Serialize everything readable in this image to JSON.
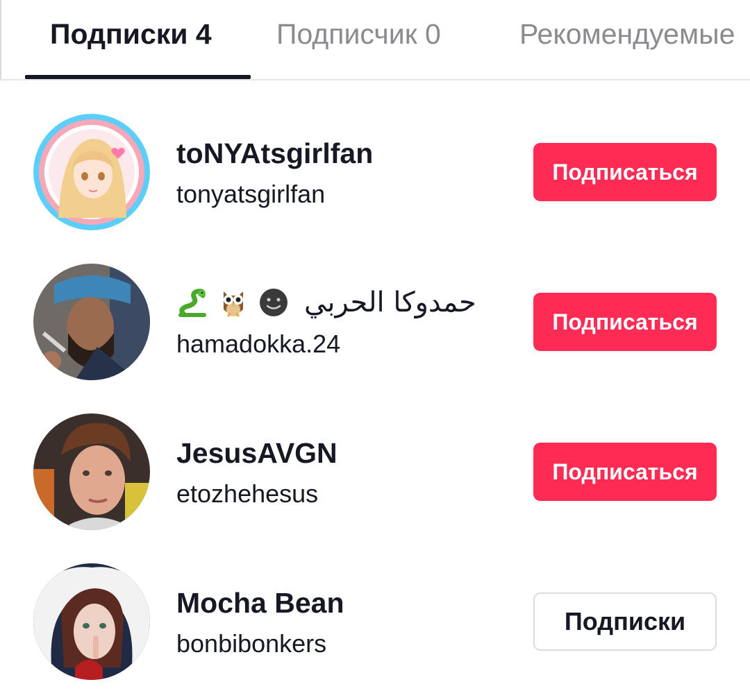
{
  "tabs": {
    "following": "Подписки 4",
    "followers": "Подписчик 0",
    "suggested": "Рекомендуемые"
  },
  "users": [
    {
      "display_name": "toNYAtsgirlfan",
      "username": "tonyatsgirlfan",
      "button": "Подписаться",
      "state": "not-following"
    },
    {
      "display_name": "حمدوكا الحربي",
      "emoji": [
        "snake",
        "owl",
        "dark-face"
      ],
      "username": "hamadokka.24",
      "button": "Подписаться",
      "state": "not-following"
    },
    {
      "display_name": "JesusAVGN",
      "username": "etozhehesus",
      "button": "Подписаться",
      "state": "not-following"
    },
    {
      "display_name": "Mocha Bean",
      "username": "bonbibonkers",
      "button": "Подписки",
      "state": "following"
    }
  ],
  "colors": {
    "accent": "#fe2c55",
    "text": "#161823",
    "muted": "#8a8b91",
    "divider": "#e6e6e8"
  }
}
